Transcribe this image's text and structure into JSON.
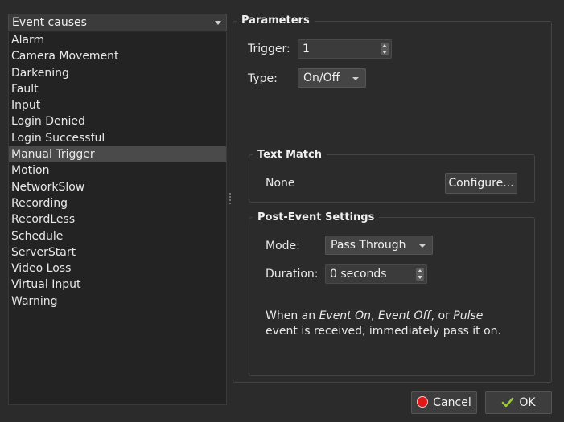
{
  "event_causes": {
    "header": "Event causes",
    "items": [
      "Alarm",
      "Camera Movement",
      "Darkening",
      "Fault",
      "Input",
      "Login Denied",
      "Login Successful",
      "Manual Trigger",
      "Motion",
      "NetworkSlow",
      "Recording",
      "RecordLess",
      "Schedule",
      "ServerStart",
      "Video Loss",
      "Virtual Input",
      "Warning"
    ],
    "selected": "Manual Trigger"
  },
  "parameters": {
    "title": "Parameters",
    "trigger_label": "Trigger:",
    "trigger_value": "1",
    "type_label": "Type:",
    "type_value": "On/Off"
  },
  "text_match": {
    "title": "Text Match",
    "value": "None",
    "configure_label": "Configure..."
  },
  "post_event": {
    "title": "Post-Event Settings",
    "mode_label": "Mode:",
    "mode_value": "Pass Through",
    "duration_label": "Duration:",
    "duration_value": "0 seconds",
    "desc_part1": "When an ",
    "desc_em1": "Event On",
    "desc_part2": ", ",
    "desc_em2": "Event Off",
    "desc_part3": ", or ",
    "desc_em3": "Pulse",
    "desc_line2": "event is received, immediately pass it on."
  },
  "footer": {
    "cancel_label": "Cancel",
    "ok_label": "OK"
  },
  "colors": {
    "background": "#2b2b2b",
    "selection": "#4a4a4a",
    "cancel_icon": "#e01818",
    "ok_icon": "#9acd32"
  }
}
